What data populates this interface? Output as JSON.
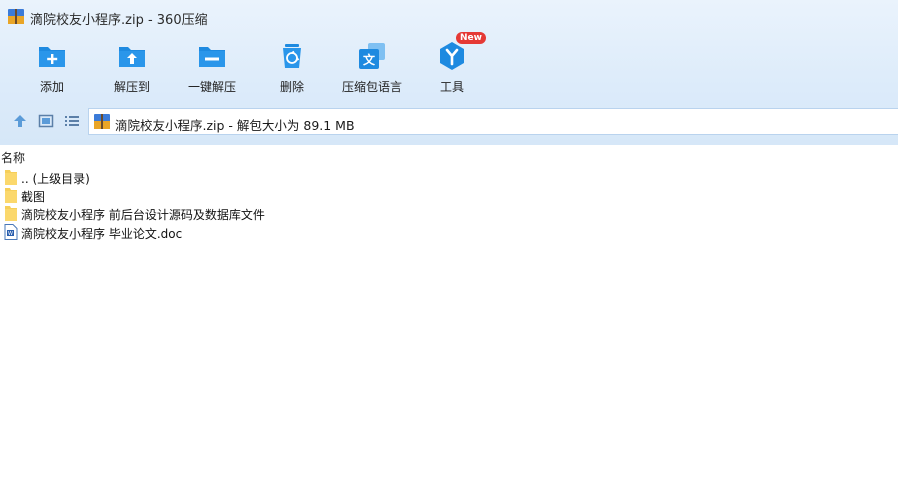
{
  "window": {
    "title": "滴院校友小程序.zip - 360压缩"
  },
  "toolbar": {
    "items": [
      {
        "label": "添加",
        "icon": "add-folder-icon"
      },
      {
        "label": "解压到",
        "icon": "extract-to-icon"
      },
      {
        "label": "一键解压",
        "icon": "one-click-extract-icon"
      },
      {
        "label": "删除",
        "icon": "delete-icon"
      },
      {
        "label": "压缩包语言",
        "icon": "archive-language-icon"
      },
      {
        "label": "工具",
        "icon": "tools-icon"
      }
    ],
    "new_badge": "New"
  },
  "nav": {
    "buttons": [
      "up-icon",
      "thumbnail-view-icon",
      "list-view-icon"
    ],
    "address": "滴院校友小程序.zip - 解包大小为 89.1 MB"
  },
  "columns": {
    "name": "名称"
  },
  "files": [
    {
      "name": ".. (上级目录)",
      "type": "folder"
    },
    {
      "name": "截图",
      "type": "folder"
    },
    {
      "name": "滴院校友小程序 前后台设计源码及数据库文件",
      "type": "folder"
    },
    {
      "name": "滴院校友小程序 毕业论文.doc",
      "type": "doc"
    }
  ],
  "colors": {
    "accent": "#1e8ae0",
    "folder": "#f6cf5a",
    "badge": "#e53935"
  }
}
